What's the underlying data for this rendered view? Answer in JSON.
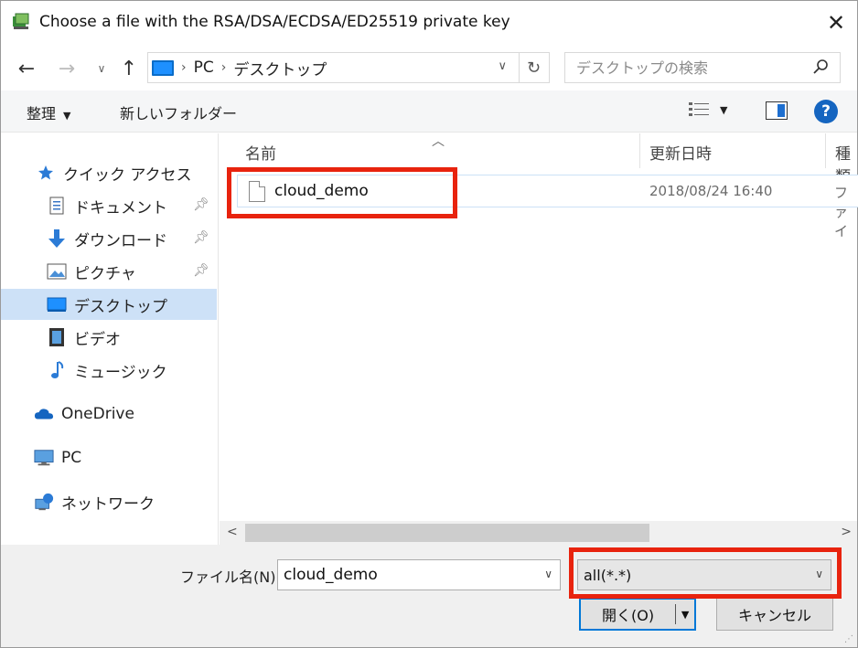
{
  "window": {
    "title": "Choose a file with the RSA/DSA/ECDSA/ED25519 private key",
    "close_glyph": "✕"
  },
  "address": {
    "crumbs": [
      "PC",
      "デスクトップ"
    ],
    "search_placeholder": "デスクトップの検索"
  },
  "toolbar": {
    "organize_label": "整理",
    "new_folder_label": "新しいフォルダー",
    "help_label": "?"
  },
  "sidebar": {
    "items": [
      {
        "label": "クイック アクセス",
        "icon": "star-icon"
      },
      {
        "label": "ドキュメント",
        "icon": "document-icon",
        "pinned": true
      },
      {
        "label": "ダウンロード",
        "icon": "download-icon",
        "pinned": true
      },
      {
        "label": "ピクチャ",
        "icon": "picture-icon",
        "pinned": true
      },
      {
        "label": "デスクトップ",
        "icon": "desktop-icon",
        "selected": true
      },
      {
        "label": "ビデオ",
        "icon": "video-icon"
      },
      {
        "label": "ミュージック",
        "icon": "music-icon"
      },
      {
        "label": "OneDrive",
        "icon": "cloud-icon"
      },
      {
        "label": "PC",
        "icon": "computer-icon"
      },
      {
        "label": "ネットワーク",
        "icon": "network-icon"
      }
    ]
  },
  "file_list": {
    "columns": [
      "名前",
      "更新日時",
      "種類"
    ],
    "rows": [
      {
        "name": "cloud_demo",
        "modified": "2018/08/24 16:40",
        "type": "ファイ"
      }
    ]
  },
  "bottom": {
    "filename_label": "ファイル名(N):",
    "filename_value": "cloud_demo",
    "filter_value": "all(*.*)",
    "open_label": "開く(O)",
    "cancel_label": "キャンセル"
  },
  "colors": {
    "highlight": "#e8230e",
    "selection": "#cde1f7",
    "accent": "#0078d7"
  }
}
